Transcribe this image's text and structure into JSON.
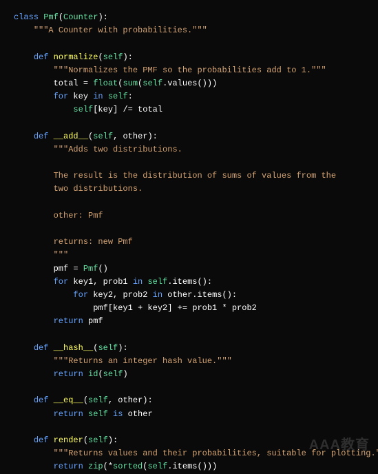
{
  "watermark": "AAA教育",
  "code": {
    "lines": [
      [
        [
          "kw",
          "class"
        ],
        [
          "id",
          " "
        ],
        [
          "cls",
          "Pmf"
        ],
        [
          "op",
          "("
        ],
        [
          "cls",
          "Counter"
        ],
        [
          "op",
          "):"
        ]
      ],
      [
        [
          "id",
          "    "
        ],
        [
          "str",
          "\"\"\"A Counter with probabilities.\"\"\""
        ]
      ],
      [
        [
          "id",
          ""
        ]
      ],
      [
        [
          "id",
          "    "
        ],
        [
          "kw",
          "def"
        ],
        [
          "id",
          " "
        ],
        [
          "fn",
          "normalize"
        ],
        [
          "op",
          "("
        ],
        [
          "self",
          "self"
        ],
        [
          "op",
          "):"
        ]
      ],
      [
        [
          "id",
          "        "
        ],
        [
          "str",
          "\"\"\"Normalizes the PMF so the probabilities add to 1.\"\"\""
        ]
      ],
      [
        [
          "id",
          "        total = "
        ],
        [
          "builtin",
          "float"
        ],
        [
          "op",
          "("
        ],
        [
          "builtin",
          "sum"
        ],
        [
          "op",
          "("
        ],
        [
          "self",
          "self"
        ],
        [
          "op",
          ".values()))"
        ]
      ],
      [
        [
          "id",
          "        "
        ],
        [
          "kw",
          "for"
        ],
        [
          "id",
          " key "
        ],
        [
          "kw",
          "in"
        ],
        [
          "id",
          " "
        ],
        [
          "self",
          "self"
        ],
        [
          "op",
          ":"
        ]
      ],
      [
        [
          "id",
          "            "
        ],
        [
          "self",
          "self"
        ],
        [
          "op",
          "[key] /= total"
        ]
      ],
      [
        [
          "id",
          ""
        ]
      ],
      [
        [
          "id",
          "    "
        ],
        [
          "kw",
          "def"
        ],
        [
          "id",
          " "
        ],
        [
          "fn",
          "__add__"
        ],
        [
          "op",
          "("
        ],
        [
          "self",
          "self"
        ],
        [
          "op",
          ", other):"
        ]
      ],
      [
        [
          "id",
          "        "
        ],
        [
          "str",
          "\"\"\"Adds two distributions."
        ]
      ],
      [
        [
          "id",
          ""
        ]
      ],
      [
        [
          "id",
          "        "
        ],
        [
          "str",
          "The result is the distribution of sums of values from the"
        ]
      ],
      [
        [
          "id",
          "        "
        ],
        [
          "str",
          "two distributions."
        ]
      ],
      [
        [
          "id",
          ""
        ]
      ],
      [
        [
          "id",
          "        "
        ],
        [
          "str",
          "other: Pmf"
        ]
      ],
      [
        [
          "id",
          ""
        ]
      ],
      [
        [
          "id",
          "        "
        ],
        [
          "str",
          "returns: new Pmf"
        ]
      ],
      [
        [
          "id",
          "        "
        ],
        [
          "str",
          "\"\"\""
        ]
      ],
      [
        [
          "id",
          "        pmf = "
        ],
        [
          "cls",
          "Pmf"
        ],
        [
          "op",
          "()"
        ]
      ],
      [
        [
          "id",
          "        "
        ],
        [
          "kw",
          "for"
        ],
        [
          "id",
          " key1, prob1 "
        ],
        [
          "kw",
          "in"
        ],
        [
          "id",
          " "
        ],
        [
          "self",
          "self"
        ],
        [
          "op",
          ".items():"
        ]
      ],
      [
        [
          "id",
          "            "
        ],
        [
          "kw",
          "for"
        ],
        [
          "id",
          " key2, prob2 "
        ],
        [
          "kw",
          "in"
        ],
        [
          "id",
          " other.items():"
        ]
      ],
      [
        [
          "id",
          "                pmf[key1 + key2] += prob1 * prob2"
        ]
      ],
      [
        [
          "id",
          "        "
        ],
        [
          "kw",
          "return"
        ],
        [
          "id",
          " pmf"
        ]
      ],
      [
        [
          "id",
          ""
        ]
      ],
      [
        [
          "id",
          "    "
        ],
        [
          "kw",
          "def"
        ],
        [
          "id",
          " "
        ],
        [
          "fn",
          "__hash__"
        ],
        [
          "op",
          "("
        ],
        [
          "self",
          "self"
        ],
        [
          "op",
          "):"
        ]
      ],
      [
        [
          "id",
          "        "
        ],
        [
          "str",
          "\"\"\"Returns an integer hash value.\"\"\""
        ]
      ],
      [
        [
          "id",
          "        "
        ],
        [
          "kw",
          "return"
        ],
        [
          "id",
          " "
        ],
        [
          "builtin",
          "id"
        ],
        [
          "op",
          "("
        ],
        [
          "self",
          "self"
        ],
        [
          "op",
          ")"
        ]
      ],
      [
        [
          "id",
          ""
        ]
      ],
      [
        [
          "id",
          "    "
        ],
        [
          "kw",
          "def"
        ],
        [
          "id",
          " "
        ],
        [
          "fn",
          "__eq__"
        ],
        [
          "op",
          "("
        ],
        [
          "self",
          "self"
        ],
        [
          "op",
          ", other):"
        ]
      ],
      [
        [
          "id",
          "        "
        ],
        [
          "kw",
          "return"
        ],
        [
          "id",
          " "
        ],
        [
          "self",
          "self"
        ],
        [
          "id",
          " "
        ],
        [
          "kw",
          "is"
        ],
        [
          "id",
          " other"
        ]
      ],
      [
        [
          "id",
          ""
        ]
      ],
      [
        [
          "id",
          "    "
        ],
        [
          "kw",
          "def"
        ],
        [
          "id",
          " "
        ],
        [
          "fn",
          "render"
        ],
        [
          "op",
          "("
        ],
        [
          "self",
          "self"
        ],
        [
          "op",
          "):"
        ]
      ],
      [
        [
          "id",
          "        "
        ],
        [
          "str",
          "\"\"\"Returns values and their probabilities, suitable for plotting.\"\"\""
        ]
      ],
      [
        [
          "id",
          "        "
        ],
        [
          "kw",
          "return"
        ],
        [
          "id",
          " "
        ],
        [
          "builtin",
          "zip"
        ],
        [
          "op",
          "(*"
        ],
        [
          "builtin",
          "sorted"
        ],
        [
          "op",
          "("
        ],
        [
          "self",
          "self"
        ],
        [
          "op",
          ".items()))"
        ]
      ]
    ]
  }
}
